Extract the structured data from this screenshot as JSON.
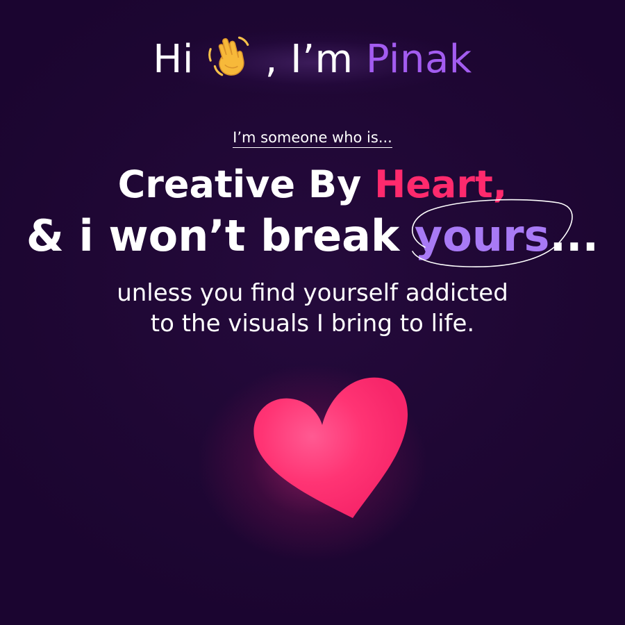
{
  "greeting": {
    "prefix": "Hi",
    "middle": ", I’m",
    "name": "Pinak",
    "wave_icon": "waving-hand-icon"
  },
  "tagline": "I’m someone who is...",
  "headline": {
    "line1_part1": "Creative By",
    "line1_accent": "Heart,",
    "line2_part1": "& i won’t break",
    "line2_accent": "yours",
    "line2_suffix": "..."
  },
  "subtext": {
    "line1": "unless you find yourself addicted",
    "line2": "to the visuals I bring to life."
  },
  "heart_icon": "heart-icon",
  "colors": {
    "background": "#1e0632",
    "name_accent": "#a35cf0",
    "heart_accent": "#ff2a6d",
    "yours_accent": "#a87af5",
    "text": "#ffffff"
  }
}
